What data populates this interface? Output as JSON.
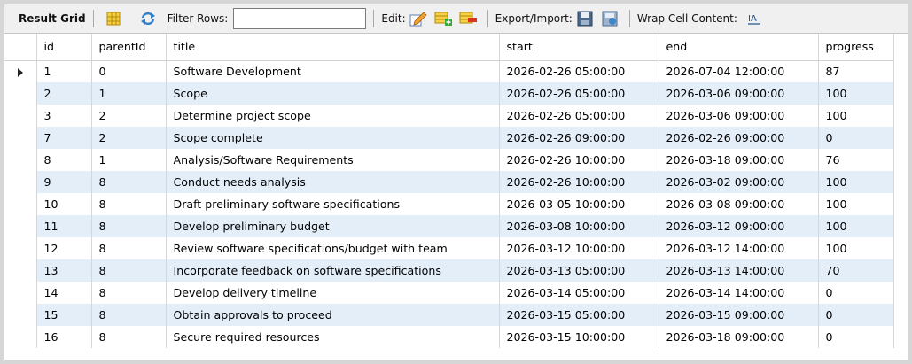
{
  "toolbar": {
    "result_grid_label": "Result Grid",
    "filter_label": "Filter Rows:",
    "filter_value": "",
    "edit_label": "Edit:",
    "export_label": "Export/Import:",
    "wrap_label": "Wrap Cell Content:",
    "icons": [
      "grid-view-icon",
      "refresh-icon",
      "edit-row-icon",
      "add-row-icon",
      "delete-row-icon",
      "export-icon",
      "import-icon",
      "wrap-text-icon"
    ]
  },
  "grid": {
    "columns": [
      "id",
      "parentId",
      "title",
      "start",
      "end",
      "progress"
    ],
    "selected_row_marker": "▶",
    "rows": [
      {
        "id": "1",
        "parentId": "0",
        "title": "Software Development",
        "start": "2026-02-26 05:00:00",
        "end": "2026-07-04 12:00:00",
        "progress": "87"
      },
      {
        "id": "2",
        "parentId": "1",
        "title": "Scope",
        "start": "2026-02-26 05:00:00",
        "end": "2026-03-06 09:00:00",
        "progress": "100"
      },
      {
        "id": "3",
        "parentId": "2",
        "title": "Determine project scope",
        "start": "2026-02-26 05:00:00",
        "end": "2026-03-06 09:00:00",
        "progress": "100"
      },
      {
        "id": "7",
        "parentId": "2",
        "title": "Scope complete",
        "start": "2026-02-26 09:00:00",
        "end": "2026-02-26 09:00:00",
        "progress": "0"
      },
      {
        "id": "8",
        "parentId": "1",
        "title": "Analysis/Software Requirements",
        "start": "2026-02-26 10:00:00",
        "end": "2026-03-18 09:00:00",
        "progress": "76"
      },
      {
        "id": "9",
        "parentId": "8",
        "title": "Conduct needs analysis",
        "start": "2026-02-26 10:00:00",
        "end": "2026-03-02 09:00:00",
        "progress": "100"
      },
      {
        "id": "10",
        "parentId": "8",
        "title": "Draft preliminary software specifications",
        "start": "2026-03-05 10:00:00",
        "end": "2026-03-08 09:00:00",
        "progress": "100"
      },
      {
        "id": "11",
        "parentId": "8",
        "title": "Develop preliminary budget",
        "start": "2026-03-08 10:00:00",
        "end": "2026-03-12 09:00:00",
        "progress": "100"
      },
      {
        "id": "12",
        "parentId": "8",
        "title": "Review software specifications/budget with team",
        "start": "2026-03-12 10:00:00",
        "end": "2026-03-12 14:00:00",
        "progress": "100"
      },
      {
        "id": "13",
        "parentId": "8",
        "title": "Incorporate feedback on software specifications",
        "start": "2026-03-13 05:00:00",
        "end": "2026-03-13 14:00:00",
        "progress": "70"
      },
      {
        "id": "14",
        "parentId": "8",
        "title": "Develop delivery timeline",
        "start": "2026-03-14 05:00:00",
        "end": "2026-03-14 14:00:00",
        "progress": "0"
      },
      {
        "id": "15",
        "parentId": "8",
        "title": "Obtain approvals to proceed",
        "start": "2026-03-15 05:00:00",
        "end": "2026-03-15 09:00:00",
        "progress": "0"
      },
      {
        "id": "16",
        "parentId": "8",
        "title": "Secure required resources",
        "start": "2026-03-15 10:00:00",
        "end": "2026-03-18 09:00:00",
        "progress": "0"
      }
    ]
  }
}
